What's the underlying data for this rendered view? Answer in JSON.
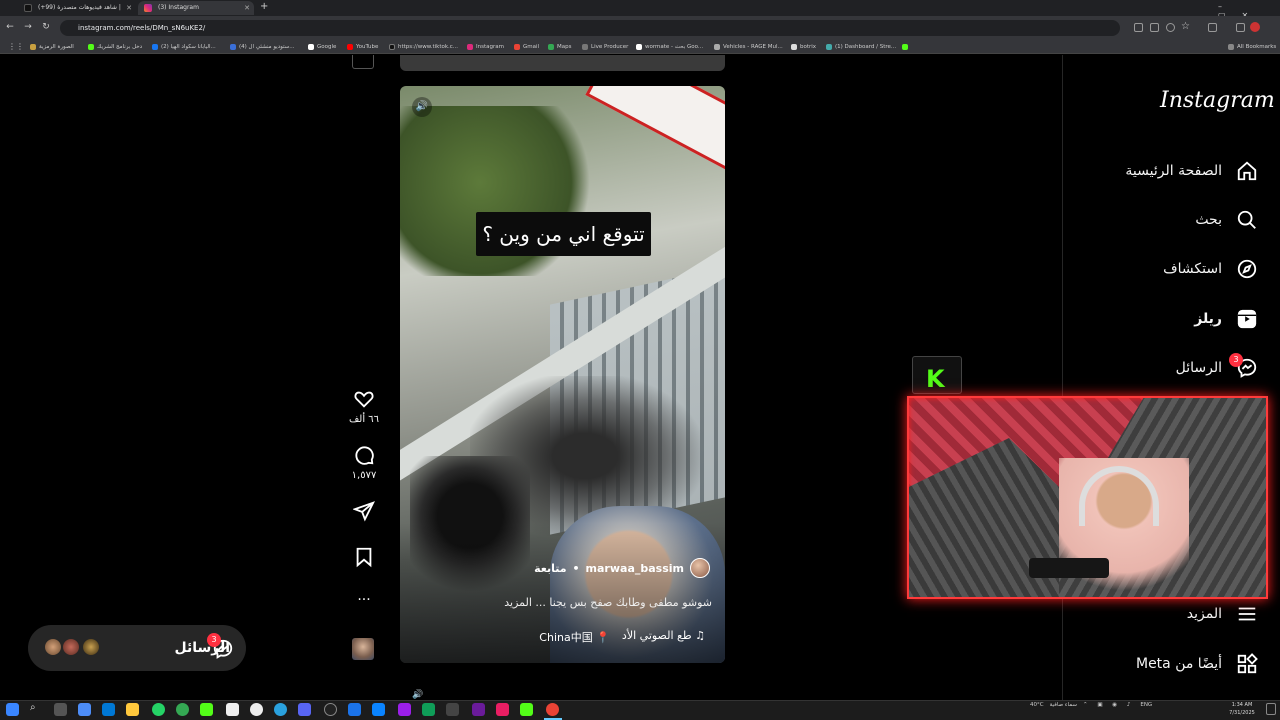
{
  "browser": {
    "tabs": [
      {
        "label": "(+99) شاهد فيديوهات متصدرة |",
        "active": false
      },
      {
        "label": "(3) Instagram",
        "active": true
      }
    ],
    "url": "instagram.com/reels/DMn_sN6uKE2/",
    "bookmarks": [
      "الصورة الرمزية",
      "دخل برنامج الشريك",
      "(2) اليابانا سكواد الهيا...",
      "(4) ستوديو منشئي ال...",
      "Google",
      "YouTube",
      "https://www.tiktok.c...",
      "Instagram",
      "Gmail",
      "Maps",
      "Live Producer",
      "wormate - بحث Goo...",
      "Vehicles - RAGE Mul...",
      "botrix",
      "(1) Dashboard / Stre..."
    ],
    "all_bookmarks_label": "All Bookmarks"
  },
  "sidebar": {
    "logo": "Instagram",
    "items": [
      {
        "label": "الصفحة الرئيسية",
        "icon": "home-icon"
      },
      {
        "label": "بحث",
        "icon": "search-icon"
      },
      {
        "label": "استكشاف",
        "icon": "compass-icon"
      },
      {
        "label": "ريلز",
        "icon": "reels-icon"
      },
      {
        "label": "الرسائل",
        "icon": "messenger-icon",
        "badge": "3"
      },
      {
        "label": "المزيد",
        "icon": "menu-icon"
      },
      {
        "label": "أيضًا من Meta",
        "icon": "grid-icon"
      }
    ]
  },
  "reel": {
    "caption_overlay": "تتوقع اني من وين ؟",
    "author": "marwaa_bassim",
    "follow_label": "متابعة",
    "description": "شوشو مطفى وطابك صفح بس يجنا ... المزيد",
    "audio": "طع الصوتي الأد",
    "location": "China中国",
    "likes": "٦٦ ألف",
    "comments": "١,٥٧٧"
  },
  "messages_pill": {
    "label": "الرسائل",
    "badge": "3"
  },
  "overlay": {
    "k_logo": "K"
  },
  "taskbar": {
    "weather": "40°C",
    "weather_text": "سماء صافية",
    "lang": "ENG",
    "time": "1:34 AM",
    "date": "7/31/2025"
  },
  "colors": {
    "badge": "#ff3040",
    "kick_green": "#53fc18",
    "webcam_border": "#ff3b3b"
  }
}
